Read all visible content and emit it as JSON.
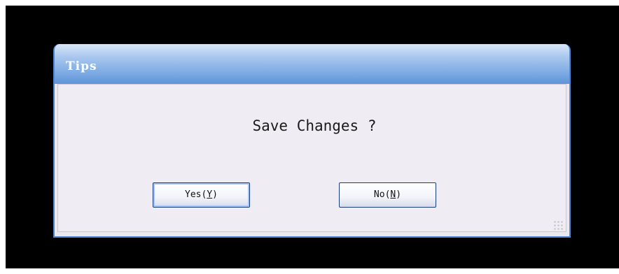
{
  "dialog": {
    "title": "Tips",
    "message": "Save Changes ?",
    "buttons": {
      "yes": {
        "prefix": "Yes(",
        "mnemonic": "Y",
        "suffix": ")"
      },
      "no": {
        "prefix": "No(",
        "mnemonic": "N",
        "suffix": ")"
      }
    }
  },
  "icons": {
    "resize_grip": "resize-grip-icon"
  },
  "colors": {
    "background": "#000000",
    "title_bar": "#7aa8e2",
    "dialog_body": "#efedf3",
    "button_border": "#1b3e7a"
  }
}
